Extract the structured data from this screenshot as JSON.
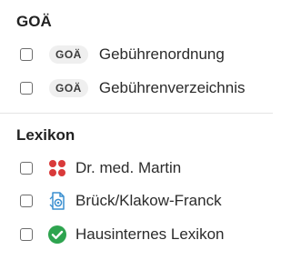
{
  "goae_section": {
    "title": "GOÄ",
    "items": [
      {
        "badge": "GOÄ",
        "label": "Gebührenordnung"
      },
      {
        "badge": "GOÄ",
        "label": "Gebührenverzeichnis"
      }
    ]
  },
  "lexikon_section": {
    "title": "Lexikon",
    "items": [
      {
        "icon": "four-red-dots-icon",
        "label": "Dr. med. Martin"
      },
      {
        "icon": "blue-document-icon",
        "label": "Brück/Klakow-Franck"
      },
      {
        "icon": "green-check-circle-icon",
        "label": "Hausinternes Lexikon"
      }
    ]
  },
  "colors": {
    "dots_red": "#d93a3a",
    "doc_blue": "#3a8fd0",
    "check_green": "#2ea44f"
  }
}
